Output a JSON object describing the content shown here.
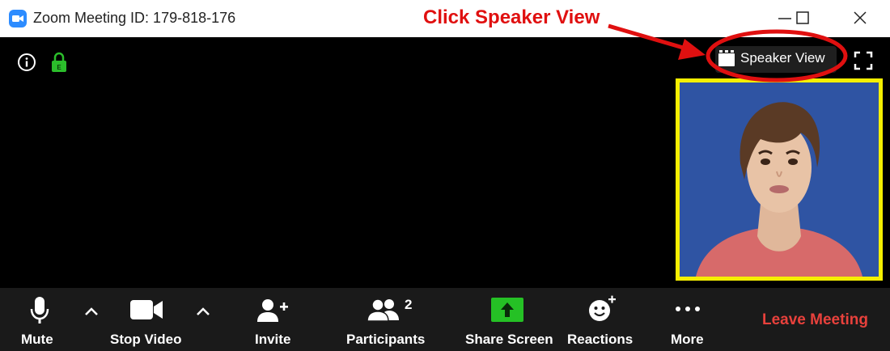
{
  "window": {
    "title": "Zoom Meeting ID: 179-818-176"
  },
  "annotation": {
    "text": "Click ",
    "emphasis": "Speaker View",
    "color": "#e01010"
  },
  "view_toggle": {
    "label": "Speaker View",
    "icon": "speaker-view-icon"
  },
  "toolbar": {
    "mute": "Mute",
    "stop_video": "Stop Video",
    "invite": "Invite",
    "participants": "Participants",
    "participants_count": "2",
    "share_screen": "Share Screen",
    "reactions": "Reactions",
    "more": "More",
    "leave": "Leave Meeting"
  },
  "colors": {
    "zoom_blue": "#2D8CFF",
    "highlight": "#f5ef00",
    "leave_red": "#e8413c",
    "share_green": "#25c125",
    "lock_green": "#2bbd2b"
  },
  "icons": [
    "info-icon",
    "encryption-lock-icon",
    "fullscreen-icon",
    "microphone-icon",
    "video-camera-icon",
    "add-user-icon",
    "participants-icon",
    "share-screen-icon",
    "reactions-icon",
    "more-icon"
  ]
}
